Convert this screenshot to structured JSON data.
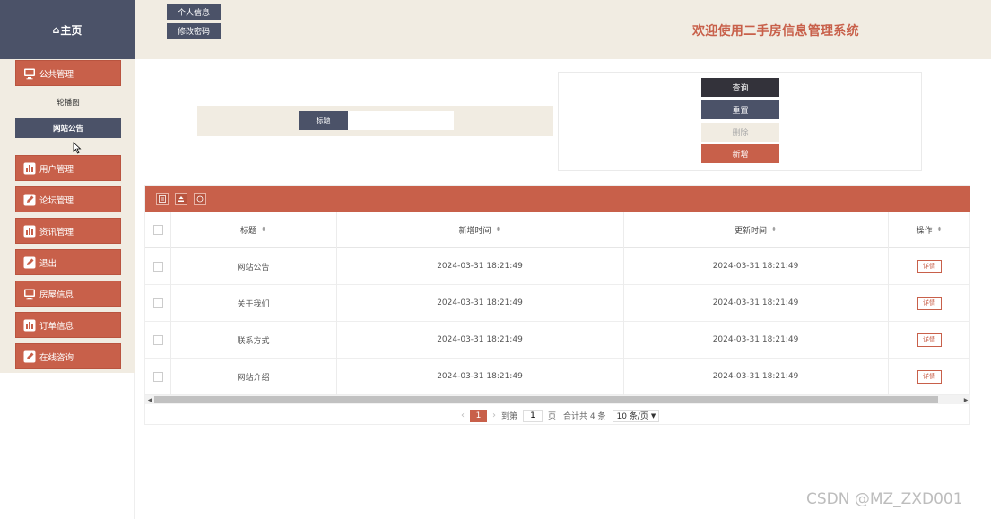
{
  "sidebar": {
    "home_label": "主页",
    "menu": [
      {
        "label": "公共管理",
        "icon": "monitor-icon"
      },
      {
        "label": "用户管理",
        "icon": "chart-icon"
      },
      {
        "label": "论坛管理",
        "icon": "edit-icon"
      },
      {
        "label": "资讯管理",
        "icon": "chart-icon"
      },
      {
        "label": "退出",
        "icon": "edit-icon"
      },
      {
        "label": "房屋信息",
        "icon": "monitor-icon"
      },
      {
        "label": "订单信息",
        "icon": "chart-icon"
      },
      {
        "label": "在线咨询",
        "icon": "edit-icon"
      }
    ],
    "submenu": [
      {
        "label": "轮播图"
      },
      {
        "label": "网站公告"
      }
    ]
  },
  "header": {
    "buttons": [
      {
        "label": "个人信息"
      },
      {
        "label": "修改密码"
      }
    ],
    "title": "欢迎使用二手房信息管理系统"
  },
  "search": {
    "label": "标题",
    "value": "",
    "placeholder": ""
  },
  "actions": {
    "query": "查询",
    "reset": "重置",
    "delete": "删除",
    "add": "新增"
  },
  "colors": {
    "primary": "#c8604a",
    "dark": "#4b5268",
    "cream": "#f1ece2",
    "query_button": "#33323a"
  },
  "table": {
    "columns": [
      "标题",
      "新增时间",
      "更新时间",
      "操作"
    ],
    "rows": [
      {
        "title": "网站公告",
        "created": "2024-03-31 18:21:49",
        "updated": "2024-03-31 18:21:49",
        "action": "详情"
      },
      {
        "title": "关于我们",
        "created": "2024-03-31 18:21:49",
        "updated": "2024-03-31 18:21:49",
        "action": "详情"
      },
      {
        "title": "联系方式",
        "created": "2024-03-31 18:21:49",
        "updated": "2024-03-31 18:21:49",
        "action": "详情"
      },
      {
        "title": "网站介绍",
        "created": "2024-03-31 18:21:49",
        "updated": "2024-03-31 18:21:49",
        "action": "详情"
      }
    ]
  },
  "pagination": {
    "prev": "‹",
    "current": "1",
    "next": "›",
    "goto_label": "到第",
    "goto_value": "1",
    "page_unit": "页",
    "total": "合计共 4 条",
    "page_size": "10 条/页"
  },
  "watermark": "CSDN @MZ_ZXD001"
}
